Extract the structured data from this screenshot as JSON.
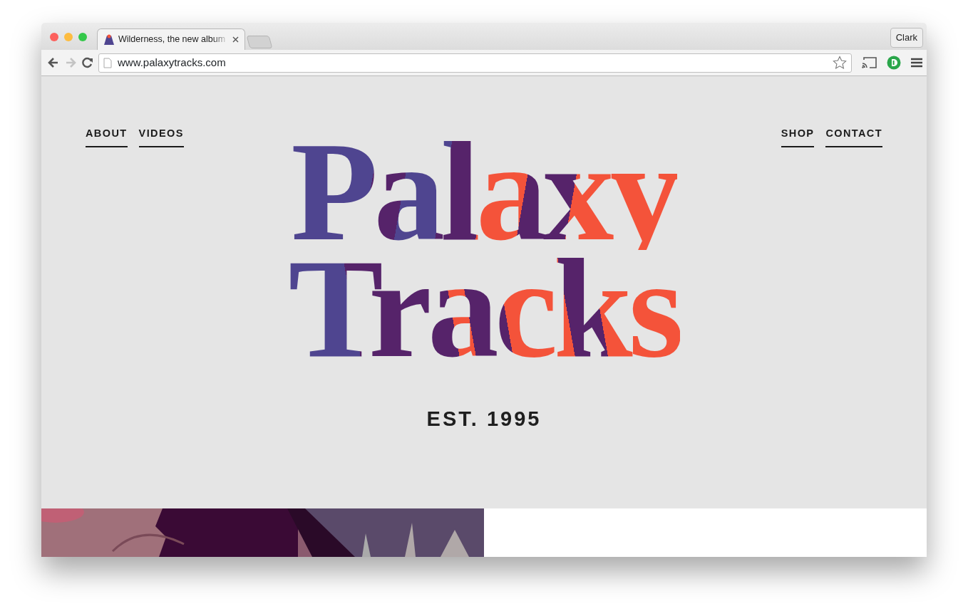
{
  "browser": {
    "tabs": [
      {
        "title": "Wilderness, the new album",
        "selected": true,
        "kind": "page"
      },
      {
        "kind": "new",
        "selected": false
      }
    ],
    "user": "Clark",
    "nav_buttons": [
      {
        "kind": "back",
        "disabled": false
      },
      {
        "kind": "forward",
        "disabled": true
      },
      {
        "kind": "reload",
        "disabled": false
      }
    ],
    "address": "www.palaxytracks.com"
  },
  "nav_left": [
    {
      "label": "ABOUT"
    },
    {
      "label": "VIDEOS"
    }
  ],
  "nav_right": [
    {
      "label": "SHOP"
    },
    {
      "label": "CONTACT"
    }
  ],
  "logo": [
    "Palaxy",
    "Tracks"
  ],
  "tagline": "EST. 1995"
}
